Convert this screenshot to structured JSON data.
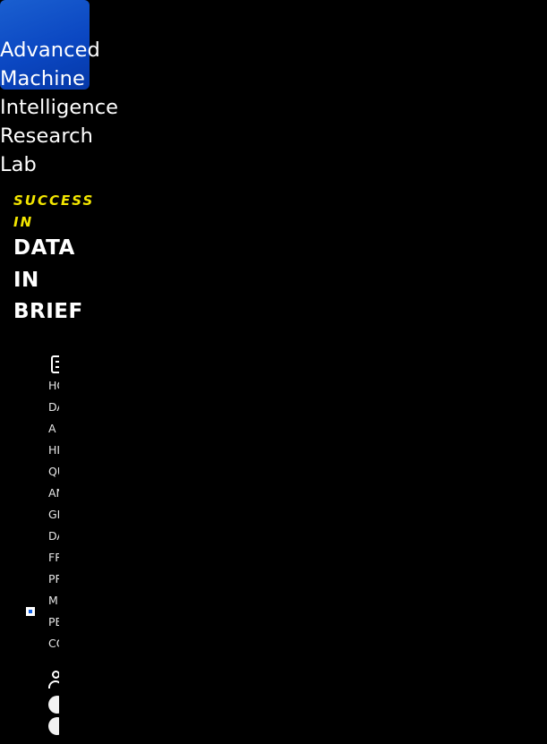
{
  "logo": {
    "name": "Advanced Machine Intelligence Research Lab"
  },
  "tagline": {
    "accent": "SUCCESS IN",
    "main": "DATA IN BRIEF"
  },
  "nav": {
    "icon": "menu-icon",
    "items": [
      {
        "label": "HO"
      },
      {
        "label": "DA"
      },
      {
        "label": "A"
      },
      {
        "label": "HI"
      },
      {
        "label": "QU"
      },
      {
        "label": "AN"
      },
      {
        "label": "GE"
      },
      {
        "label": "DA"
      },
      {
        "label": "FR"
      },
      {
        "label": "PR"
      },
      {
        "label": "M",
        "active": true
      },
      {
        "label": "PE"
      },
      {
        "label": "CO"
      }
    ]
  },
  "user": {
    "icon": "user-icon",
    "social_icons": [
      "social-icon-1",
      "social-icon-2",
      "social-icon-3"
    ]
  },
  "colors": {
    "background": "#000000",
    "logo_blue": "#0b47c2",
    "accent_yellow": "#f3e600",
    "active_marker": "#1463e6",
    "text": "#ffffff"
  }
}
